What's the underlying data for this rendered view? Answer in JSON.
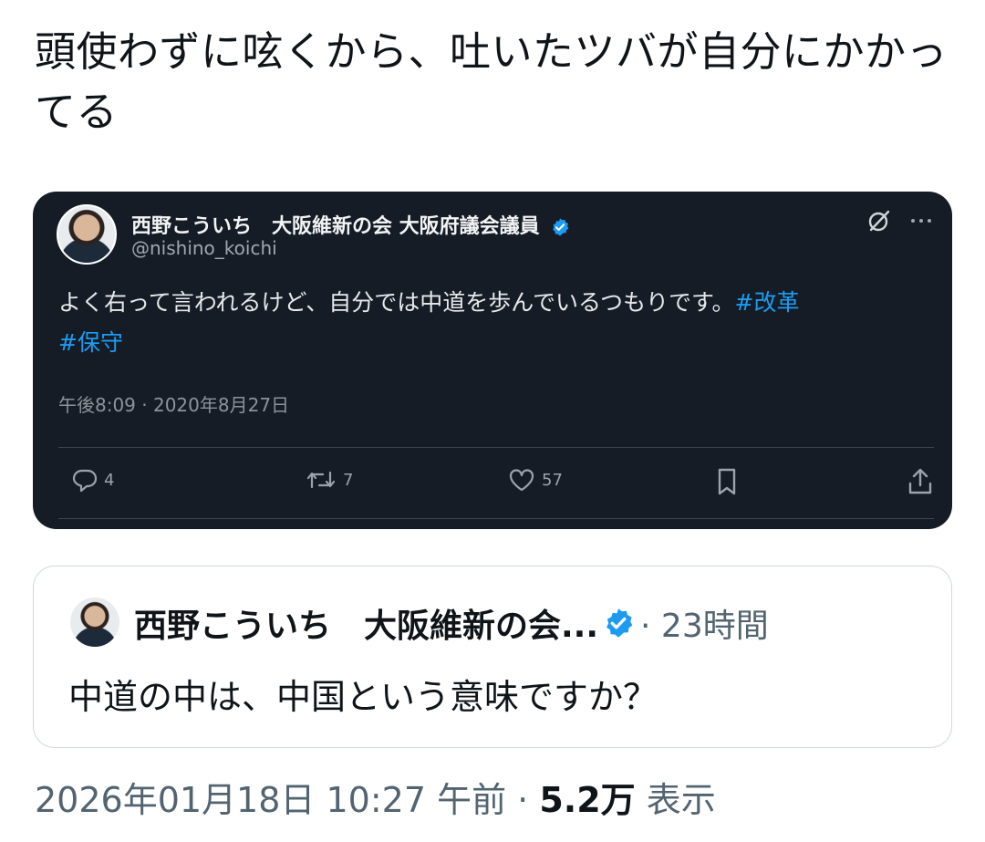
{
  "post": {
    "text": "頭使わずに呟くから、吐いたツバが自分にかかってる"
  },
  "embedded_tweet": {
    "display_name": "西野こういち　大阪維新の会 大阪府議会議員",
    "handle": "@nishino_koichi",
    "body_text": "よく右って言われるけど、自分では中道を歩んでいるつもりです。",
    "hashtags": [
      "#改革",
      "#保守"
    ],
    "timestamp": "午後8:09 · 2020年8月27日",
    "replies": "4",
    "retweets": "7",
    "likes": "57",
    "verified_color": "#1d9bf0",
    "icons": [
      "grok-icon",
      "more-icon",
      "reply-icon",
      "retweet-icon",
      "like-icon",
      "bookmark-icon",
      "share-icon"
    ]
  },
  "quote": {
    "display_name": "西野こういち　大阪維新の会...",
    "meta": "· 23時間",
    "text": "中道の中は、中国という意味ですか？"
  },
  "footer": {
    "timestamp": "2026年01月18日 10:27 午前 ·",
    "views_count": "5.2万",
    "views_label": "表示"
  }
}
